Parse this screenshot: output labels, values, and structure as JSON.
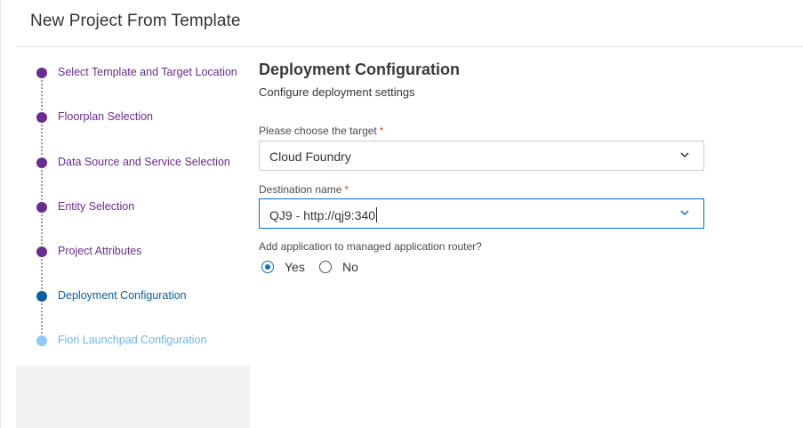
{
  "header": {
    "title": "New Project From Template"
  },
  "steps": [
    {
      "label": "Select Template and Target Location",
      "state": "done"
    },
    {
      "label": "Floorplan Selection",
      "state": "done"
    },
    {
      "label": "Data Source and Service Selection",
      "state": "done"
    },
    {
      "label": "Entity Selection",
      "state": "done"
    },
    {
      "label": "Project Attributes",
      "state": "done"
    },
    {
      "label": "Deployment Configuration",
      "state": "current"
    },
    {
      "label": "Fiori Launchpad Configuration",
      "state": "pending"
    }
  ],
  "main": {
    "title": "Deployment Configuration",
    "subtitle": "Configure deployment settings",
    "target": {
      "label": "Please choose the target",
      "required_mark": "*",
      "value": "Cloud Foundry"
    },
    "destination": {
      "label": "Destination name",
      "required_mark": "*",
      "value": "QJ9 - http://qj9:340"
    },
    "router": {
      "question": "Add application to managed application router?",
      "options": [
        {
          "label": "Yes",
          "checked": true
        },
        {
          "label": "No",
          "checked": false
        }
      ]
    }
  },
  "colors": {
    "done": "#6a2c91",
    "current": "#0a5fa0",
    "pending": "#8ec8f5",
    "accent": "#0a6ed1",
    "required": "#e04a3a"
  },
  "icons": {
    "dropdown": "chevron-down-icon"
  }
}
